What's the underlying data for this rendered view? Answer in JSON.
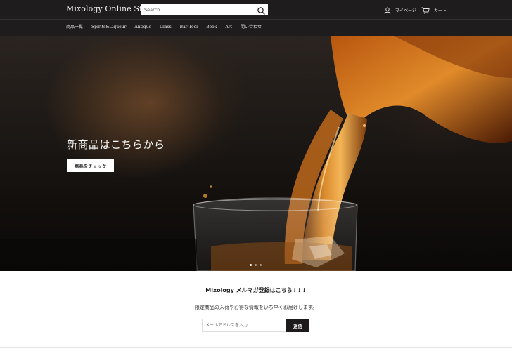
{
  "header": {
    "logo": "Mixology Online Store",
    "search_placeholder": "Search...",
    "account_label": "マイページ",
    "cart_label": "カート"
  },
  "nav": {
    "items": [
      {
        "label": "商品一覧"
      },
      {
        "label": "Spirits&Liqueur"
      },
      {
        "label": "Antique"
      },
      {
        "label": "Glass"
      },
      {
        "label": "Bar Tool"
      },
      {
        "label": "Book"
      },
      {
        "label": "Art"
      },
      {
        "label": "問い合わせ"
      }
    ]
  },
  "hero": {
    "title": "新商品はこちらから",
    "button_label": "商品をチェック",
    "slide_count": 3,
    "active_slide": 1
  },
  "newsletter": {
    "title": "Mixology メルマガ登録はこちら↓↓↓",
    "description": "限定商品の入荷やお得な情報をいち早くお届けします。",
    "email_placeholder": "メールアドレスを入力",
    "submit_label": "送信"
  },
  "colors": {
    "header_bg": "#1f1c1e",
    "button_dark": "#1c1a1b",
    "whisky_amber": "#c9701a"
  }
}
